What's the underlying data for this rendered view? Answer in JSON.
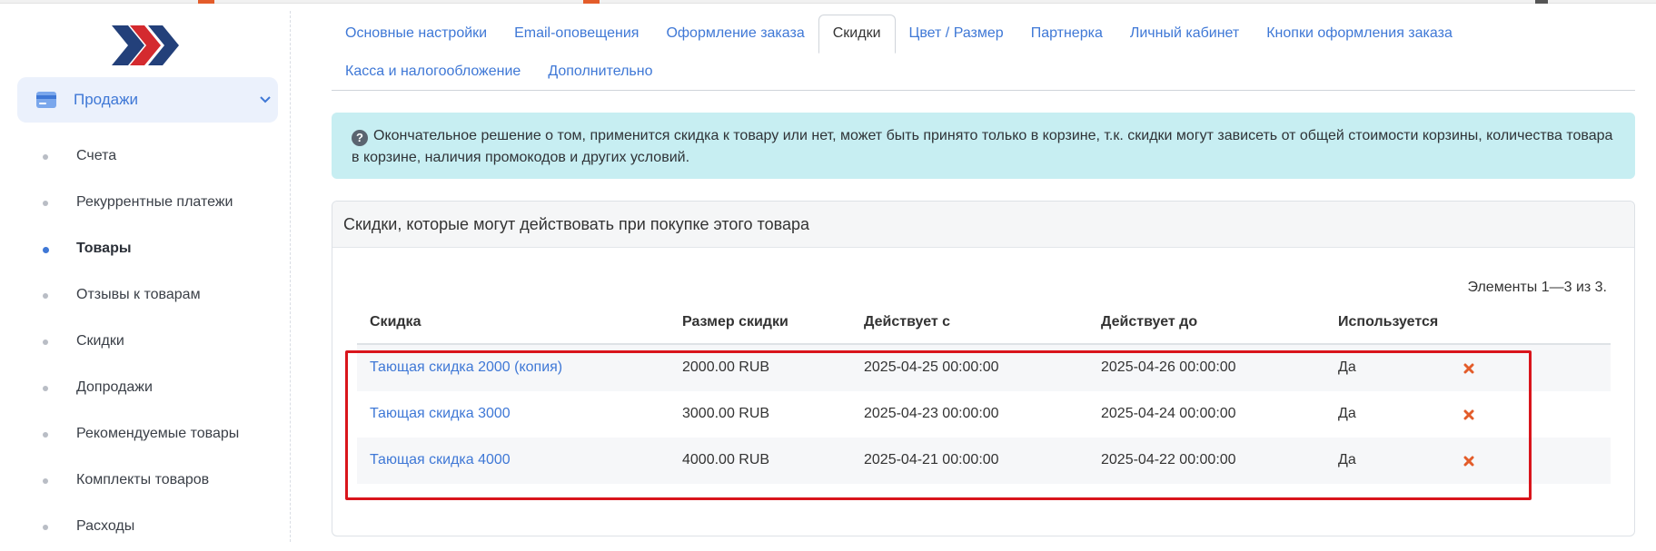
{
  "sidebar": {
    "section": {
      "label": "Продажи"
    },
    "items": [
      {
        "label": "Счета",
        "active": false
      },
      {
        "label": "Рекуррентные платежи",
        "active": false
      },
      {
        "label": "Товары",
        "active": true
      },
      {
        "label": "Отзывы к товарам",
        "active": false
      },
      {
        "label": "Скидки",
        "active": false
      },
      {
        "label": "Допродажи",
        "active": false
      },
      {
        "label": "Рекомендуемые товары",
        "active": false
      },
      {
        "label": "Комплекты товаров",
        "active": false
      },
      {
        "label": "Расходы",
        "active": false
      }
    ]
  },
  "tabs": {
    "row1": [
      "Основные настройки",
      "Email-оповещения",
      "Оформление заказа",
      "Скидки",
      "Цвет / Размер",
      "Партнерка",
      "Личный кабинет",
      "Кнопки оформления заказа"
    ],
    "row2": [
      "Касса и налогообложение",
      "Дополнительно"
    ],
    "active": "Скидки"
  },
  "alert": {
    "icon": "question-icon",
    "text": "Окончательное решение о том, применится скидка к товару или нет, может быть принято только в корзине, т.к. скидки могут зависеть от общей стоимости корзины, количества товара в корзине, наличия промокодов и других условий."
  },
  "card": {
    "title": "Скидки, которые могут действовать при покупке этого товара",
    "summary": "Элементы 1—3 из 3.",
    "columns": [
      "Скидка",
      "Размер скидки",
      "Действует с",
      "Действует до",
      "Используется"
    ],
    "rows": [
      {
        "name": "Тающая скидка 2000 (копия)",
        "amount": "2000.00 RUB",
        "from": "2025-04-25 00:00:00",
        "to": "2025-04-26 00:00:00",
        "used": "Да"
      },
      {
        "name": "Тающая скидка 3000",
        "amount": "3000.00 RUB",
        "from": "2025-04-23 00:00:00",
        "to": "2025-04-24 00:00:00",
        "used": "Да"
      },
      {
        "name": "Тающая скидка 4000",
        "amount": "4000.00 RUB",
        "from": "2025-04-21 00:00:00",
        "to": "2025-04-22 00:00:00",
        "used": "Да"
      }
    ]
  },
  "colors": {
    "accent": "#3f78d6",
    "alert_bg": "#c7eef2",
    "highlight": "#d9151c",
    "logo_red": "#d42a2f",
    "logo_navy": "#23407a"
  }
}
